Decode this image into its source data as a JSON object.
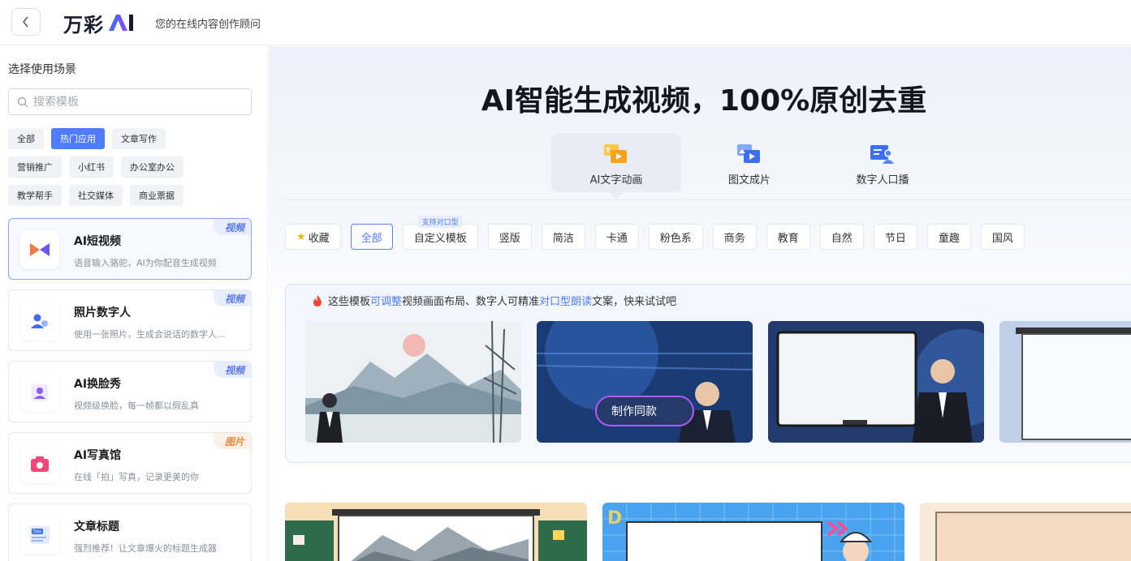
{
  "header": {
    "logo_text": "万彩",
    "logo_ai": "AI",
    "tagline": "您的在线内容创作顾问"
  },
  "sidebar": {
    "title": "选择使用场景",
    "search_placeholder": "搜索模板",
    "chips": [
      [
        "全部",
        "热门应用",
        "文章写作"
      ],
      [
        "营销推广",
        "小红书",
        "办公室办公"
      ],
      [
        "教学帮手",
        "社交媒体",
        "商业票据"
      ]
    ],
    "active_chip": "热门应用",
    "cards": [
      {
        "title": "AI短视频",
        "desc": "语音输入骆驼，AI为你配音生成视频",
        "badge": "视频",
        "badge_type": "video",
        "icon": "film-play-icon"
      },
      {
        "title": "照片数字人",
        "desc": "使用一张照片，生成会说话的数字人...",
        "badge": "视频",
        "badge_type": "video",
        "icon": "person-avatar-icon"
      },
      {
        "title": "AI换脸秀",
        "desc": "视频级换脸，每一帧都以假乱真",
        "badge": "视频",
        "badge_type": "video",
        "icon": "face-swap-icon"
      },
      {
        "title": "AI写真馆",
        "desc": "在线「拍」写真，记录更美的你",
        "badge": "图片",
        "badge_type": "image",
        "icon": "camera-icon"
      },
      {
        "title": "文章标题",
        "desc": "强烈推荐！让文章爆火的标题生成器",
        "badge": "",
        "badge_type": "",
        "icon": "title-doc-icon"
      }
    ]
  },
  "main": {
    "headline": "AI智能生成视频，100%原创去重",
    "modes": [
      {
        "label": "AI文字动画",
        "icon": "text-animation-icon"
      },
      {
        "label": "图文成片",
        "icon": "image-to-video-icon"
      },
      {
        "label": "数字人口播",
        "icon": "digital-human-icon"
      }
    ],
    "filters": [
      "收藏",
      "全部",
      "自定义模板",
      "竖版",
      "简洁",
      "卡通",
      "粉色系",
      "商务",
      "教育",
      "自然",
      "节日",
      "童趣",
      "国风"
    ],
    "filter_tag": "支持对口型",
    "promo": {
      "tip_parts": [
        "这些模板",
        "可调整",
        "视频画面布局、数字人可精准",
        "对口型朗读",
        "文案，快来试试吧"
      ],
      "make_button": "制作同款"
    }
  },
  "colors": {
    "accent": "#4d7cfe",
    "video_badge": "#5a77e8",
    "image_badge": "#e88a3a"
  }
}
